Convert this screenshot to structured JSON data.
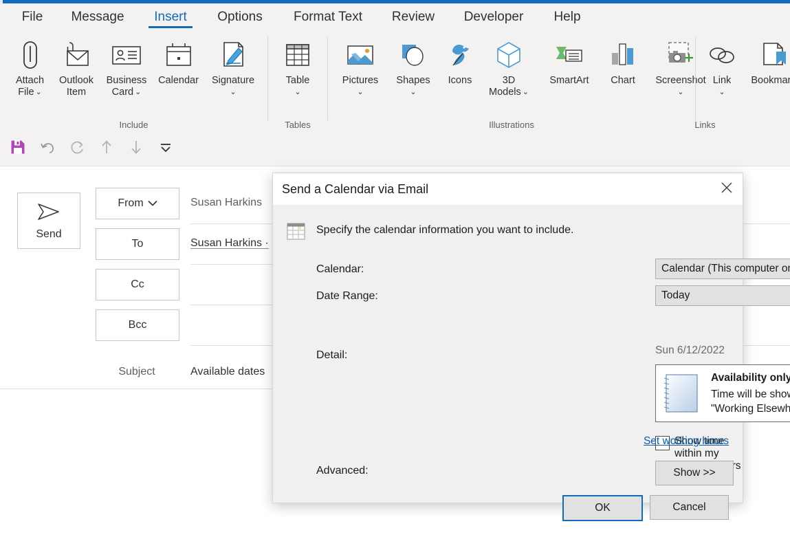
{
  "window": {
    "accent_color": "#0f6cbd"
  },
  "ribbon": {
    "tabs": [
      {
        "label": "File",
        "active": false
      },
      {
        "label": "Message",
        "active": false
      },
      {
        "label": "Insert",
        "active": true
      },
      {
        "label": "Options",
        "active": false
      },
      {
        "label": "Format Text",
        "active": false
      },
      {
        "label": "Review",
        "active": false
      },
      {
        "label": "Developer",
        "active": false
      },
      {
        "label": "Help",
        "active": false
      }
    ],
    "groups": [
      {
        "name": "Include",
        "items": [
          {
            "label_line1": "Attach",
            "label_line2": "File",
            "icon": "paperclip-icon",
            "has_chevron": true
          },
          {
            "label_line1": "Outlook",
            "label_line2": "Item",
            "icon": "envelope-clip-icon",
            "has_chevron": false
          },
          {
            "label_line1": "Business",
            "label_line2": "Card",
            "icon": "business-card-icon",
            "has_chevron": true
          },
          {
            "label_line1": "Calendar",
            "label_line2": "",
            "icon": "calendar-icon",
            "has_chevron": false
          },
          {
            "label_line1": "Signature",
            "label_line2": "",
            "icon": "signature-icon",
            "has_chevron": true
          }
        ]
      },
      {
        "name": "Tables",
        "items": [
          {
            "label_line1": "Table",
            "label_line2": "",
            "icon": "table-icon",
            "has_chevron": true
          }
        ]
      },
      {
        "name": "Illustrations",
        "items": [
          {
            "label_line1": "Pictures",
            "label_line2": "",
            "icon": "pictures-icon",
            "has_chevron": true
          },
          {
            "label_line1": "Shapes",
            "label_line2": "",
            "icon": "shapes-icon",
            "has_chevron": true
          },
          {
            "label_line1": "Icons",
            "label_line2": "",
            "icon": "icons-icon",
            "has_chevron": false
          },
          {
            "label_line1": "3D",
            "label_line2": "Models",
            "icon": "3d-models-icon",
            "has_chevron": true
          },
          {
            "label_line1": "SmartArt",
            "label_line2": "",
            "icon": "smartart-icon",
            "has_chevron": false
          },
          {
            "label_line1": "Chart",
            "label_line2": "",
            "icon": "chart-icon",
            "has_chevron": false
          },
          {
            "label_line1": "Screenshot",
            "label_line2": "",
            "icon": "screenshot-icon",
            "has_chevron": true
          }
        ]
      },
      {
        "name": "Links",
        "items": [
          {
            "label_line1": "Link",
            "label_line2": "",
            "icon": "link-icon",
            "has_chevron": true
          },
          {
            "label_line1": "Bookmark",
            "label_line2": "",
            "icon": "bookmark-icon",
            "has_chevron": false
          }
        ]
      }
    ]
  },
  "quick_access_toolbar": {
    "buttons": [
      {
        "name": "save",
        "icon": "save-icon",
        "color": "#b046b8"
      },
      {
        "name": "undo",
        "icon": "undo-icon",
        "color": "#8a8886"
      },
      {
        "name": "redo",
        "icon": "redo-icon",
        "color": "#8a8886"
      },
      {
        "name": "previous",
        "icon": "arrow-up-icon",
        "color": "#8a8886"
      },
      {
        "name": "next",
        "icon": "arrow-down-icon",
        "color": "#8a8886"
      },
      {
        "name": "customize",
        "icon": "chevron-down-bar-icon",
        "color": "#323130"
      }
    ]
  },
  "compose": {
    "send_label": "Send",
    "send_icon": "send-arrow-icon",
    "from_label": "From",
    "from_value": "Susan Harkins",
    "to_label": "To",
    "to_value": "Susan Harkins ·",
    "cc_label": "Cc",
    "cc_value": "",
    "bcc_label": "Bcc",
    "bcc_value": "",
    "subject_label": "Subject",
    "subject_value": "Available dates"
  },
  "dialog": {
    "title": "Send a Calendar via Email",
    "close_icon": "close-icon",
    "header_icon": "calendar-grid-icon",
    "intro": "Specify the calendar information you want to include.",
    "calendar_label": "Calendar:",
    "calendar_value": "Calendar (This computer only)",
    "date_range_label": "Date Range:",
    "date_range_value": "Today",
    "date_note": "Sun 6/12/2022",
    "detail_label": "Detail:",
    "detail_title": "Availability only",
    "detail_line1": "Time will be shown as \"Free,\" \"Busy,\" \"Tentative,\"",
    "detail_line2": "\"Working Elsewhere,\" or \"Out of Office\"",
    "detail_icon": "calendar-page-icon",
    "working_hours_checkbox_label": "Show time within my working hours only",
    "working_hours_checked": false,
    "set_working_hours_link": "Set working hours",
    "advanced_label": "Advanced:",
    "advanced_button": "Show >>",
    "ok_label": "OK",
    "cancel_label": "Cancel"
  }
}
